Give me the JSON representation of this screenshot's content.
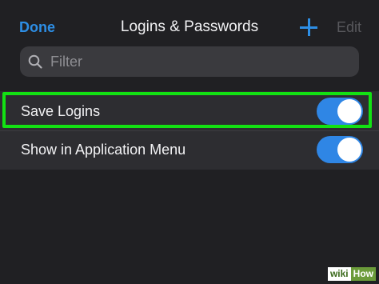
{
  "header": {
    "done_label": "Done",
    "title": "Logins & Passwords",
    "add_icon": "plus-icon",
    "edit_label": "Edit"
  },
  "search": {
    "placeholder": "Filter",
    "icon": "search-icon"
  },
  "settings": {
    "rows": [
      {
        "label": "Save Logins",
        "toggle_on": true
      },
      {
        "label": "Show in Application Menu",
        "toggle_on": true
      }
    ]
  },
  "watermark": {
    "left": "wiki",
    "right": "How"
  },
  "colors": {
    "accent": "#2d8ee5",
    "toggle_on": "#2f86e5",
    "highlight": "#13e113",
    "background": "#202023"
  }
}
